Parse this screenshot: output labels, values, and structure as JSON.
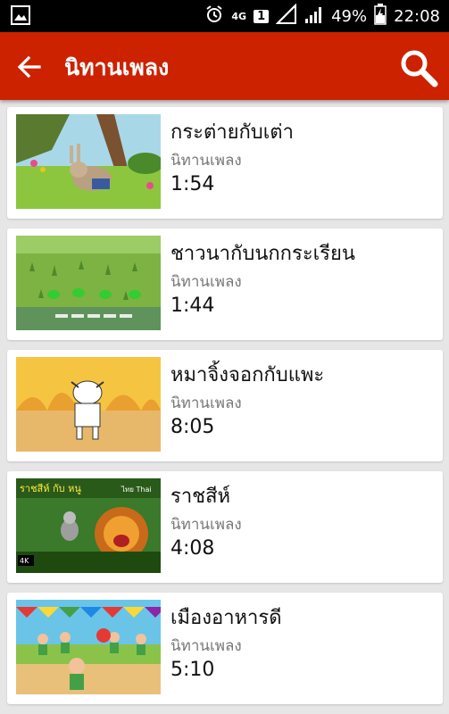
{
  "status_bar": {
    "network": "4G",
    "sim": "1",
    "battery": "49%",
    "time": "22:08"
  },
  "app_bar": {
    "title": "นิทานเพลง"
  },
  "videos": [
    {
      "title": "กระต่ายกับเต่า",
      "channel": "นิทานเพลง",
      "duration": "1:54"
    },
    {
      "title": "ชาวนากับนกกระเรียน",
      "channel": "นิทานเพลง",
      "duration": "1:44"
    },
    {
      "title": "หมาจิ้งจอกกับแพะ",
      "channel": "นิทานเพลง",
      "duration": "8:05"
    },
    {
      "title": "ราชสีห์",
      "channel": "นิทานเพลง",
      "duration": "4:08"
    },
    {
      "title": "เมืองอาหารดี",
      "channel": "นิทานเพลง",
      "duration": "5:10"
    }
  ],
  "thumbnail_text": {
    "video_4_banner": "ราชสีห์ กับ หนู",
    "video_4_badge": "ไทย Thai",
    "video_4_quality": "4K"
  },
  "colors": {
    "app_bar": "#cc2200",
    "status_bar": "#000000",
    "background": "#e6e6e6"
  }
}
